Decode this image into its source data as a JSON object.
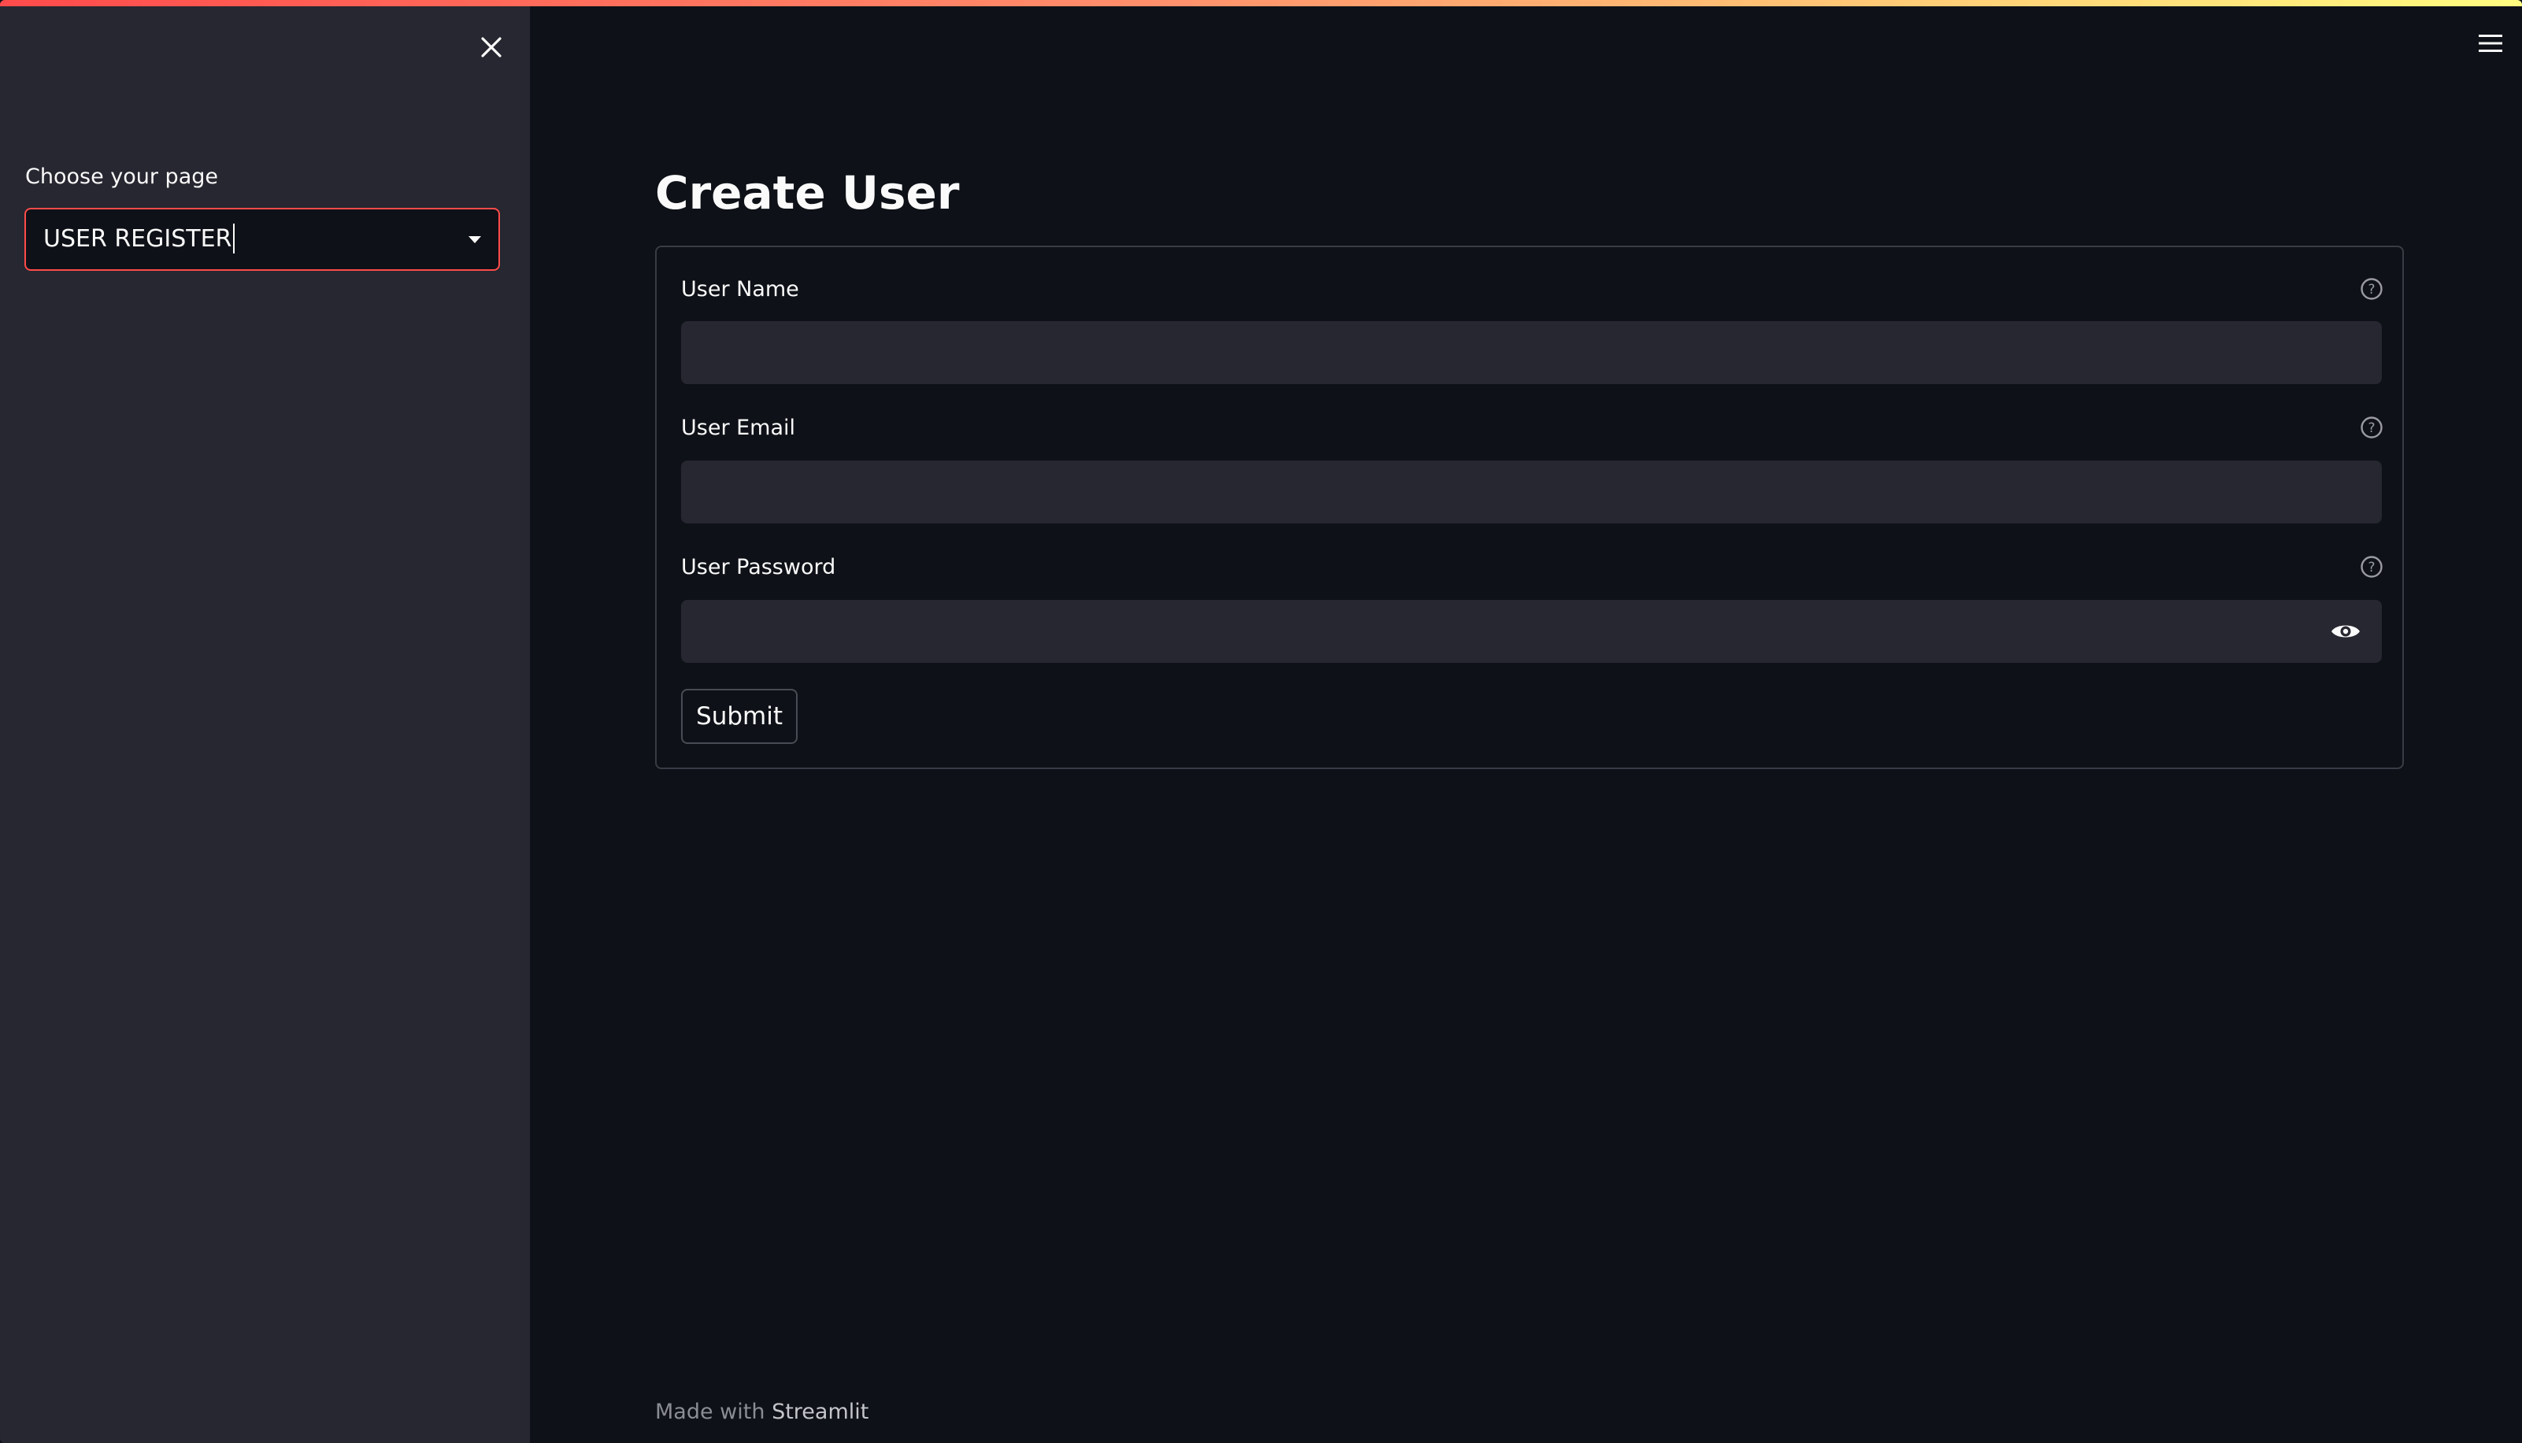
{
  "sidebar": {
    "close_icon": "close-icon",
    "select_label": "Choose your page",
    "select_value": "USER REGISTER",
    "accent_color": "#ff4b4b"
  },
  "header": {
    "menu_icon": "hamburger-menu-icon"
  },
  "main": {
    "title": "Create User",
    "form": {
      "fields": [
        {
          "label": "User Name",
          "value": "",
          "help_icon": "question-circle-icon"
        },
        {
          "label": "User Email",
          "value": "",
          "help_icon": "question-circle-icon"
        },
        {
          "label": "User Password",
          "value": "",
          "help_icon": "question-circle-icon",
          "toggle_icon": "eye-icon"
        }
      ],
      "submit_label": "Submit"
    }
  },
  "footer": {
    "prefix": "Made with",
    "brand": "Streamlit"
  },
  "colors": {
    "background": "#0e1117",
    "sidebar": "#262730",
    "input_bg": "#262730",
    "text": "#fafafa"
  }
}
